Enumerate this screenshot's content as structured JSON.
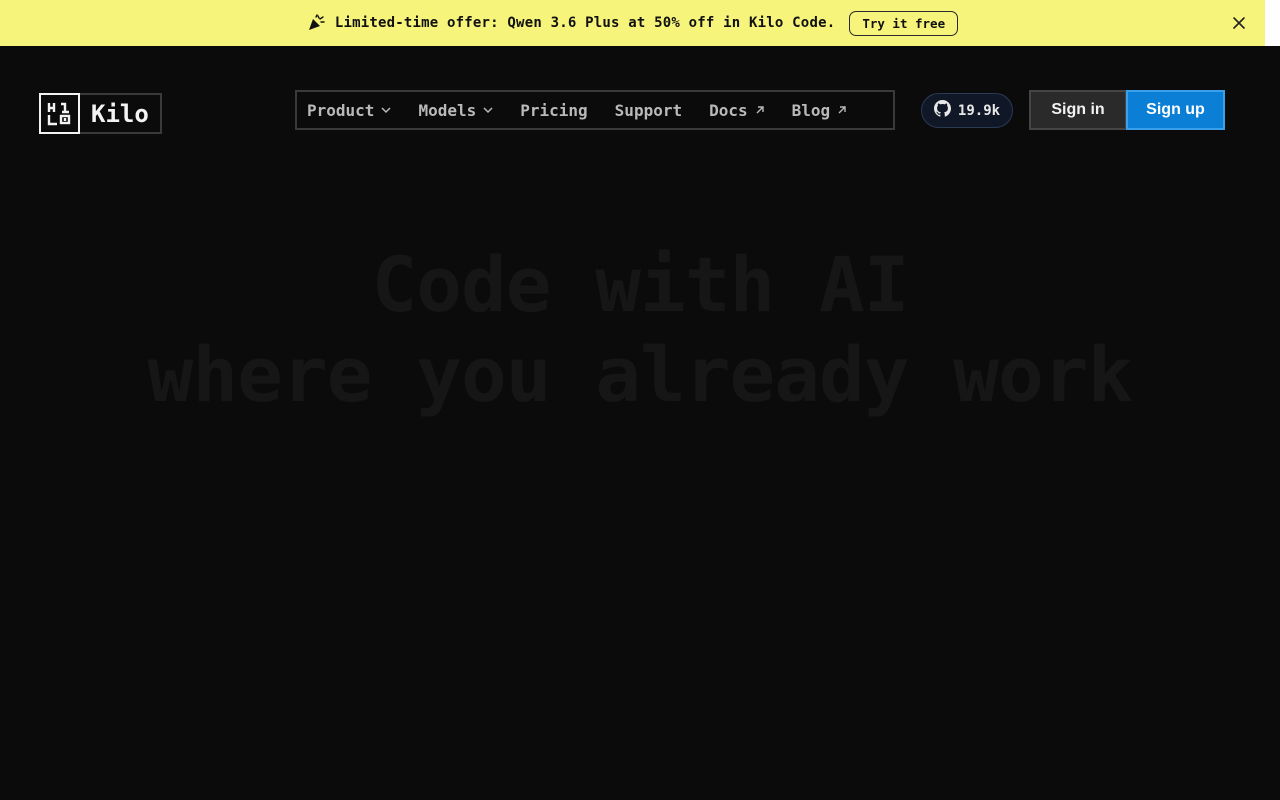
{
  "banner": {
    "icon": "party-popper-icon",
    "text": "Limited-time offer: Qwen 3.6 Plus at 50% off in Kilo Code.",
    "cta": "Try it free",
    "background": "#f6f47a"
  },
  "brand": {
    "name": "Kilo"
  },
  "nav": {
    "items": [
      {
        "label": "Product",
        "icon": "chevron-down-icon"
      },
      {
        "label": "Models",
        "icon": "chevron-down-icon"
      },
      {
        "label": "Pricing"
      },
      {
        "label": "Support"
      },
      {
        "label": "Docs",
        "icon": "external-arrow-icon"
      },
      {
        "label": "Blog",
        "icon": "external-arrow-icon"
      }
    ]
  },
  "github": {
    "stars": "19.9k",
    "icon": "github-icon"
  },
  "auth": {
    "sign_in": "Sign in",
    "sign_up": "Sign up",
    "accent": "#0b7fd6"
  },
  "hero": {
    "title_line1": "Code with AI",
    "title_line2": "where you already work",
    "subtitle": "",
    "faded": true
  }
}
